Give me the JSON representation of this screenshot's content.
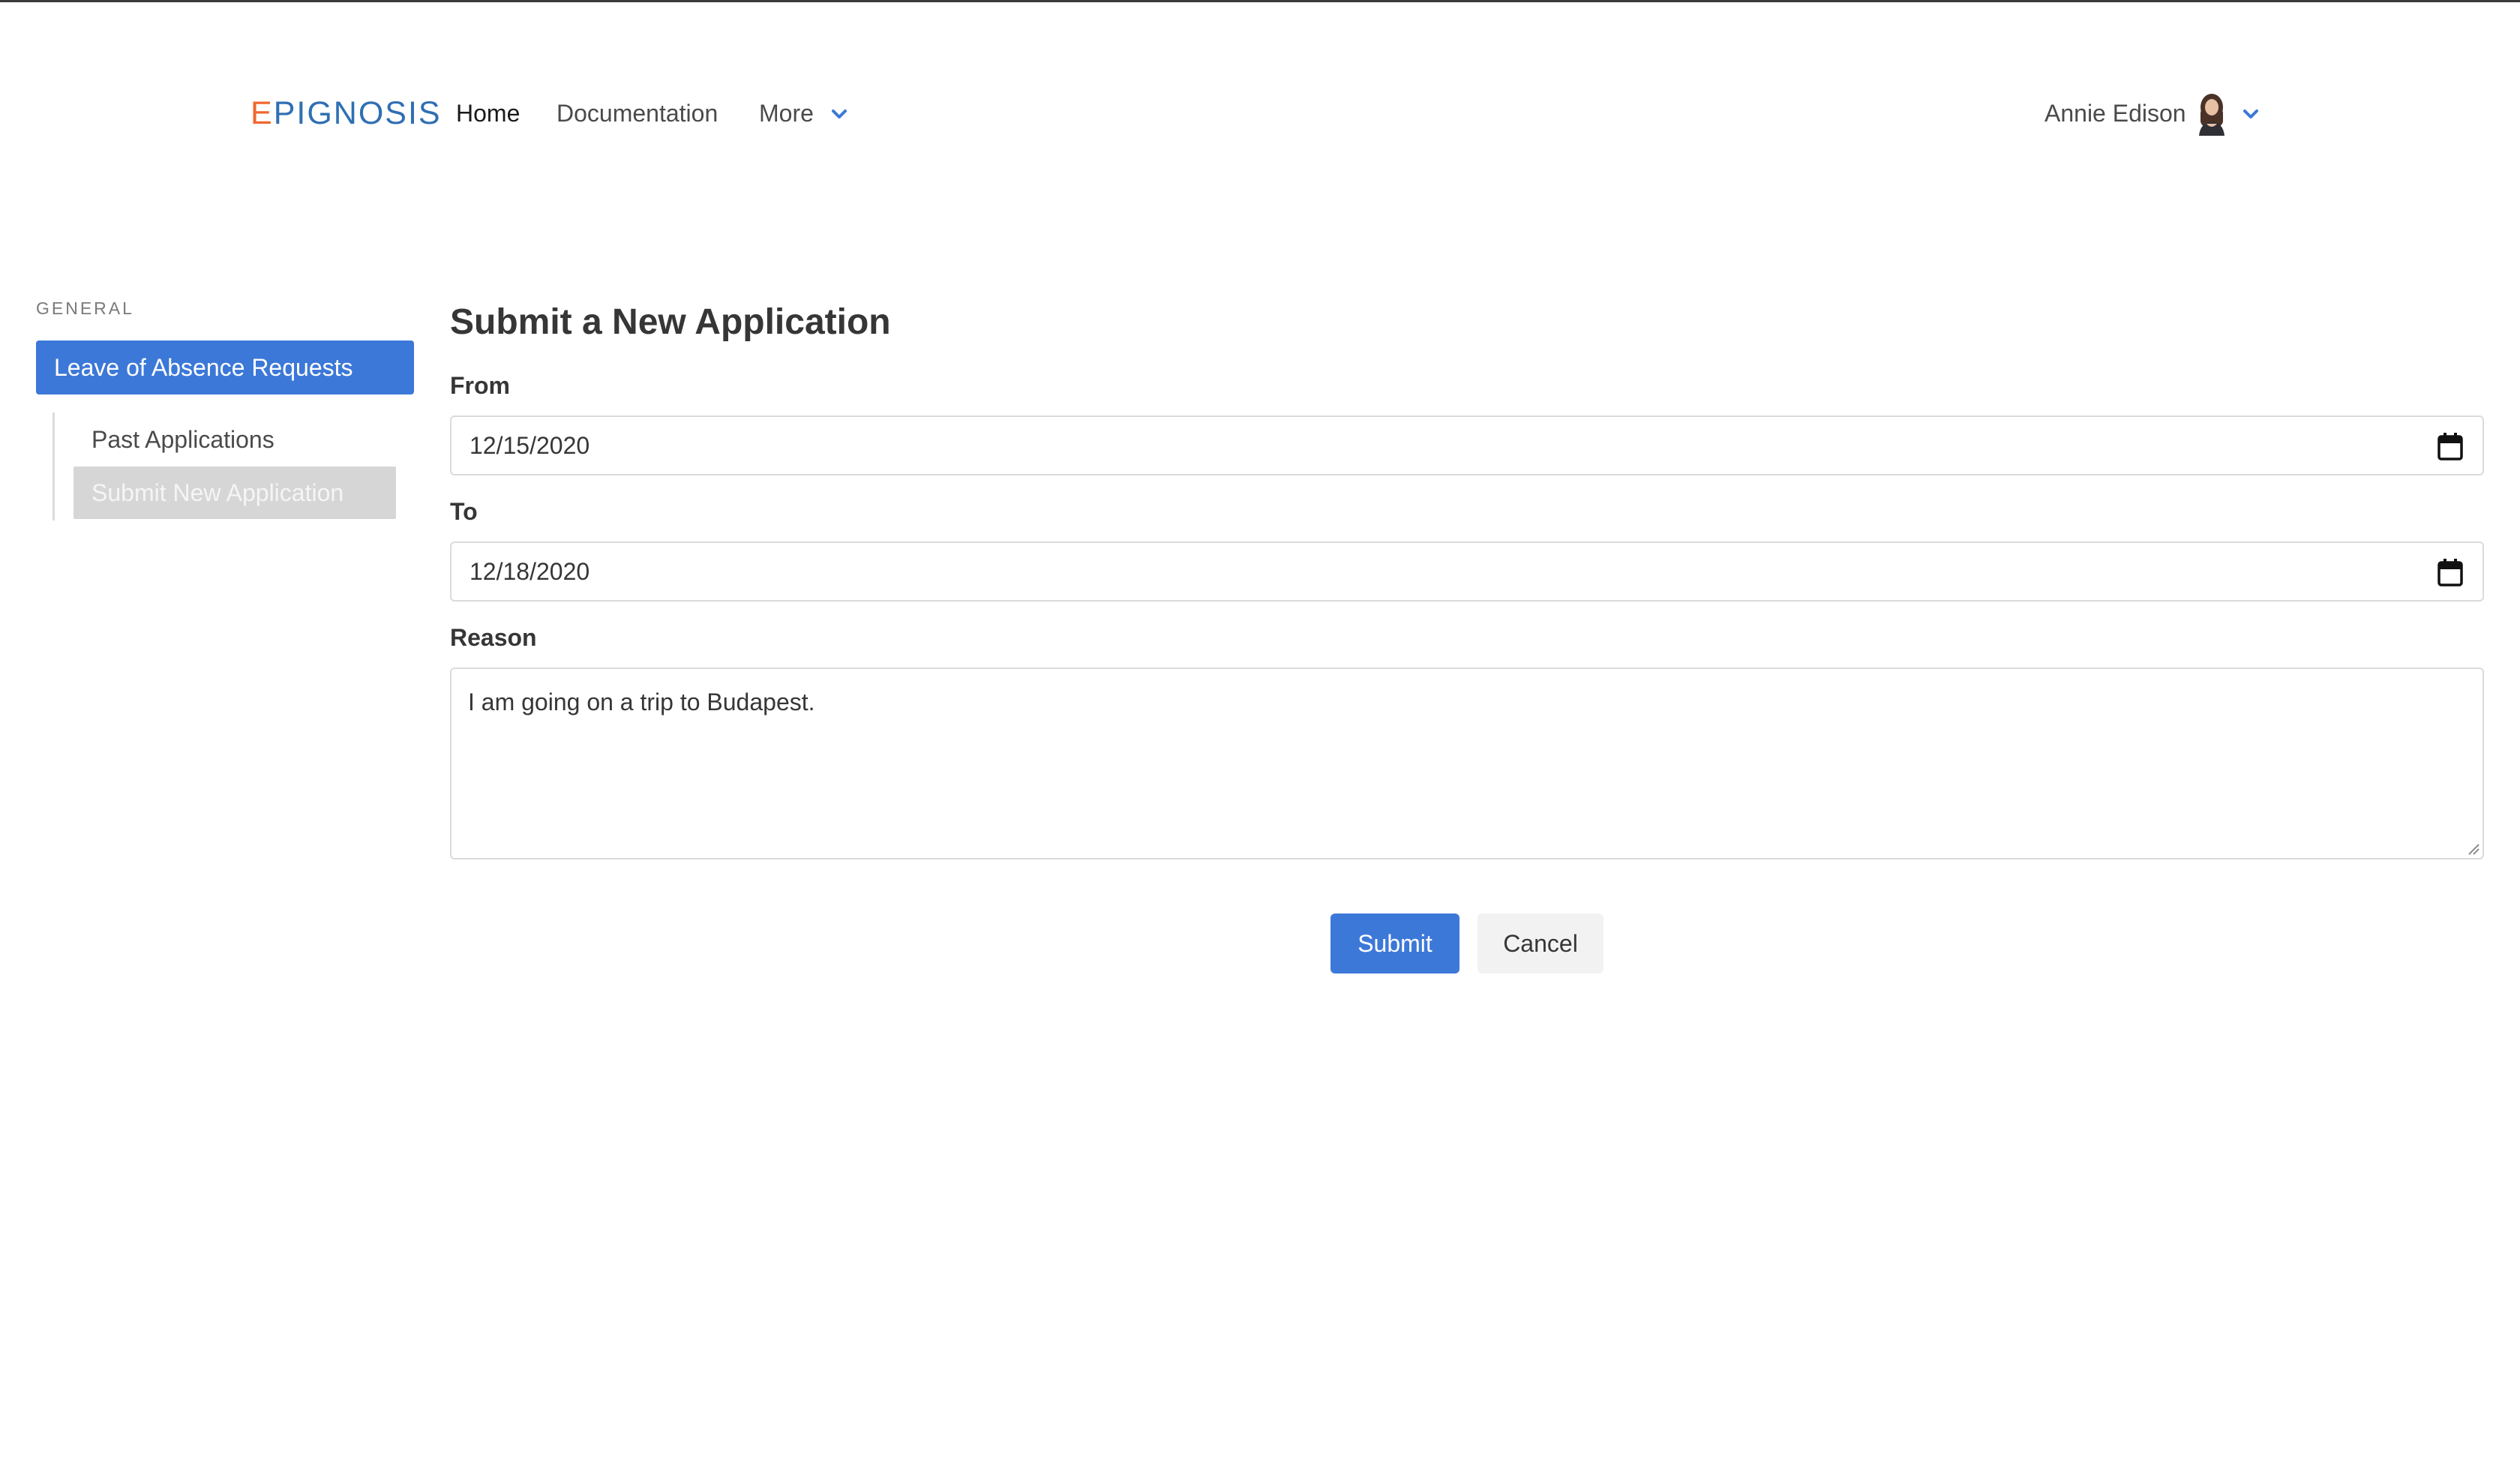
{
  "navbar": {
    "logo_mark": "E",
    "logo_rest": "PIGNOSIS",
    "links": [
      {
        "label": "Home"
      },
      {
        "label": "Documentation"
      },
      {
        "label": "More"
      }
    ],
    "user": {
      "name": "Annie Edison"
    }
  },
  "sidebar": {
    "heading": "GENERAL",
    "active_item": "Leave of Absence Requests",
    "sub_items": [
      {
        "label": "Past Applications"
      },
      {
        "label": "Submit New Application"
      }
    ]
  },
  "form": {
    "title": "Submit a New Application",
    "from": {
      "label": "From",
      "value": "12/15/2020"
    },
    "to": {
      "label": "To",
      "value": "12/18/2020"
    },
    "reason": {
      "label": "Reason",
      "value": "I am going on a trip to Budapest."
    },
    "submit_label": "Submit",
    "cancel_label": "Cancel"
  },
  "colors": {
    "accent": "#3c78d8",
    "logo_blue": "#2f6fb3",
    "logo_orange": "#f0672f",
    "selected_sub_bg": "#d6d6d6"
  },
  "icons": [
    "chevron-down-icon",
    "avatar",
    "calendar-icon",
    "resize-handle-icon"
  ]
}
